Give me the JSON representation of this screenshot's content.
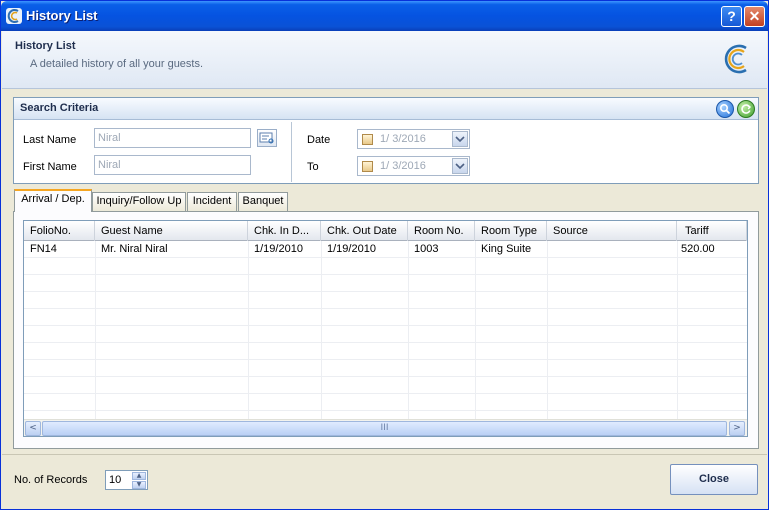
{
  "window": {
    "title": "History List"
  },
  "header": {
    "title": "History List",
    "subtitle": "A detailed history of all your guests."
  },
  "search": {
    "title": "Search Criteria",
    "last_name_label": "Last Name",
    "last_name_value": "Niral",
    "first_name_label": "First Name",
    "first_name_value": "Niral",
    "date_label": "Date",
    "date_value": "1/ 3/2016",
    "to_label": "To",
    "to_value": "1/ 3/2016"
  },
  "tabs": [
    {
      "label": "Arrival / Dep.",
      "active": true
    },
    {
      "label": "Inquiry/Follow Up",
      "active": false
    },
    {
      "label": "Incident",
      "active": false
    },
    {
      "label": "Banquet",
      "active": false
    }
  ],
  "grid": {
    "columns": [
      "FolioNo.",
      "Guest Name",
      "Chk. In D...",
      "Chk. Out Date",
      "Room No.",
      "Room Type",
      "Source",
      "Tariff"
    ],
    "rows": [
      [
        "FN14",
        "Mr. Niral Niral",
        "1/19/2010",
        "1/19/2010",
        "1003",
        "King Suite",
        "",
        "520.00"
      ]
    ]
  },
  "scrollbar": {
    "left_arrow": "<",
    "right_arrow": ">",
    "thumb_grip": "III"
  },
  "footer": {
    "records_label": "No. of Records",
    "records_value": "10",
    "close_label": "Close"
  },
  "colors": {
    "titlebar": "#0553e1",
    "tab_highlight": "#f5a623",
    "border": "#7f9db9"
  },
  "icons": [
    "app-logo-icon",
    "help-icon",
    "close-icon",
    "search-icon",
    "refresh-icon",
    "name-picker-icon",
    "calendar-dropdown-icon",
    "spin-up-icon",
    "spin-down-icon"
  ]
}
